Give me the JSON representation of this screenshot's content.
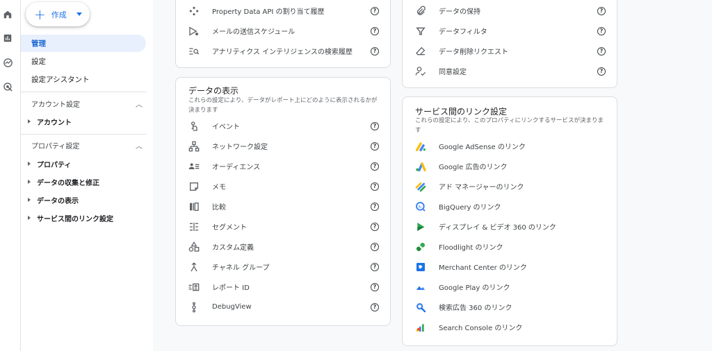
{
  "create_button": {
    "label": "作成"
  },
  "nav": {
    "admin": "管理",
    "settings": "設定",
    "setup_assistant": "設定アシスタント",
    "account_section": "アカウント設定",
    "account": "アカウント",
    "property_section": "プロパティ設定",
    "property_items": [
      "プロパティ",
      "データの収集と修正",
      "データの表示",
      "サービス間のリンク設定"
    ]
  },
  "card_top_left": {
    "items": [
      {
        "label": "Property Data API の割り当て履歴",
        "icon": "api-quota-icon"
      },
      {
        "label": "メールの送信スケジュール",
        "icon": "email-schedule-icon"
      },
      {
        "label": "アナリティクス インテリジェンスの検索履歴",
        "icon": "search-history-icon"
      }
    ]
  },
  "card_top_right": {
    "items": [
      {
        "label": "データの保持",
        "icon": "attachment-icon"
      },
      {
        "label": "データフィルタ",
        "icon": "filter-icon"
      },
      {
        "label": "データ削除リクエスト",
        "icon": "eraser-icon"
      },
      {
        "label": "同意設定",
        "icon": "consent-icon"
      }
    ]
  },
  "data_display": {
    "title": "データの表示",
    "desc": "これらの設定により、データがレポート上にどのように表示されるかが決まります",
    "items": [
      {
        "label": "イベント",
        "icon": "touch-icon"
      },
      {
        "label": "ネットワーク設定",
        "icon": "network-icon"
      },
      {
        "label": "オーディエンス",
        "icon": "audience-icon"
      },
      {
        "label": "メモ",
        "icon": "note-icon"
      },
      {
        "label": "比較",
        "icon": "compare-icon"
      },
      {
        "label": "セグメント",
        "icon": "segment-icon"
      },
      {
        "label": "カスタム定義",
        "icon": "shapes-icon"
      },
      {
        "label": "チャネル グループ",
        "icon": "merge-icon"
      },
      {
        "label": "レポート ID",
        "icon": "report-id-icon"
      },
      {
        "label": "DebugView",
        "icon": "debug-icon"
      }
    ]
  },
  "product_links": {
    "title": "サービス間のリンク設定",
    "desc": "これらの設定により、このプロパティにリンクするサービスが決まります",
    "items": [
      {
        "label": "Google AdSense のリンク",
        "icon": "adsense-icon"
      },
      {
        "label": "Google 広告のリンク",
        "icon": "google-ads-icon"
      },
      {
        "label": "アド マネージャーのリンク",
        "icon": "ad-manager-icon"
      },
      {
        "label": "BigQuery のリンク",
        "icon": "bigquery-icon"
      },
      {
        "label": "ディスプレイ & ビデオ 360 のリンク",
        "icon": "dv360-icon"
      },
      {
        "label": "Floodlight のリンク",
        "icon": "floodlight-icon"
      },
      {
        "label": "Merchant Center のリンク",
        "icon": "merchant-center-icon"
      },
      {
        "label": "Google Play のリンク",
        "icon": "google-play-icon"
      },
      {
        "label": "検索広告 360 のリンク",
        "icon": "sa360-icon"
      },
      {
        "label": "Search Console のリンク",
        "icon": "search-console-icon"
      }
    ]
  },
  "help_glyph": "?"
}
